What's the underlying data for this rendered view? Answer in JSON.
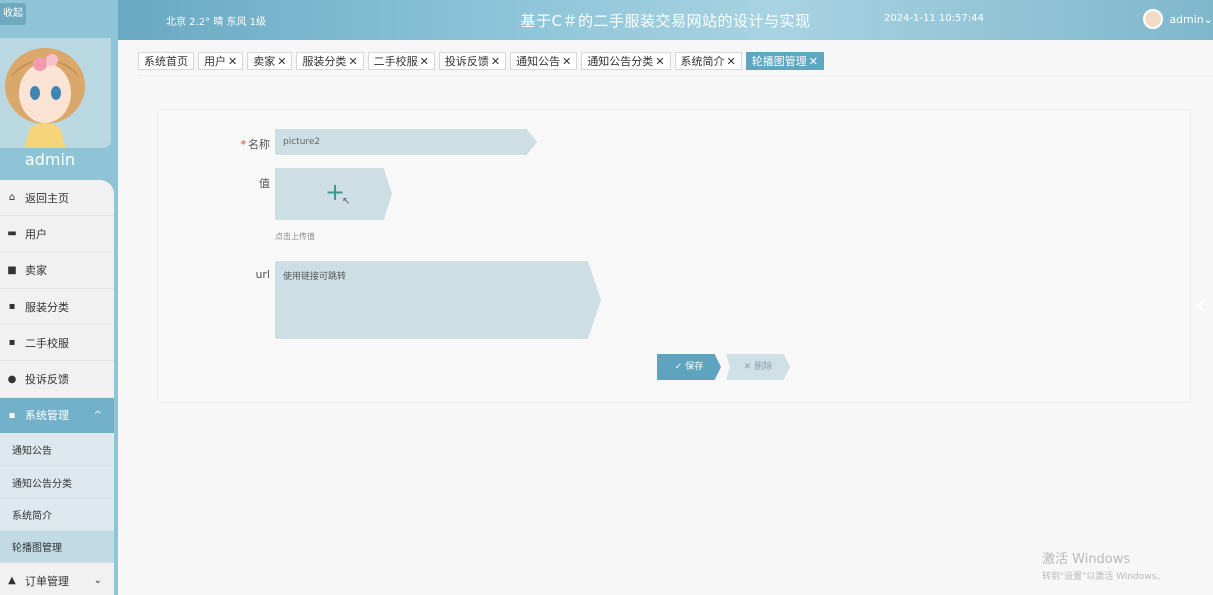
{
  "sidebar": {
    "collapse_label": "收起",
    "username": "admin",
    "menu": [
      {
        "label": "返回主页",
        "icon": "home-icon",
        "glyph": "⌂"
      },
      {
        "label": "用户",
        "icon": "user-icon",
        "glyph": "▬"
      },
      {
        "label": "卖家",
        "icon": "seller-icon",
        "glyph": "■"
      },
      {
        "label": "服装分类",
        "icon": "grid-icon",
        "glyph": "▪"
      },
      {
        "label": "二手校服",
        "icon": "grid-icon",
        "glyph": "▪"
      },
      {
        "label": "投诉反馈",
        "icon": "pin-icon",
        "glyph": "●"
      }
    ],
    "system_menu": {
      "label": "系统管理",
      "icon": "grid-icon",
      "glyph": "▪",
      "caret": "^"
    },
    "sub_items": [
      "通知公告",
      "通知公告分类",
      "系统简介",
      "轮播图管理"
    ],
    "order_menu": {
      "label": "订单管理",
      "icon": "person-icon",
      "glyph": "▲",
      "caret": "⌄"
    }
  },
  "header": {
    "weather": "北京  2.2°  晴  东风  1级",
    "title": "基于C＃的二手服装交易网站的设计与实现",
    "datetime": "2024-1-11 10:57:44",
    "username": "admin",
    "dropdown_glyph": "⌄"
  },
  "tabs": [
    {
      "label": "系统首页",
      "closable": false
    },
    {
      "label": "用户",
      "closable": true
    },
    {
      "label": "卖家",
      "closable": true
    },
    {
      "label": "服装分类",
      "closable": true
    },
    {
      "label": "二手校服",
      "closable": true
    },
    {
      "label": "投诉反馈",
      "closable": true
    },
    {
      "label": "通知公告",
      "closable": true
    },
    {
      "label": "通知公告分类",
      "closable": true
    },
    {
      "label": "系统简介",
      "closable": true
    },
    {
      "label": "轮播图管理",
      "closable": true,
      "active": true
    }
  ],
  "form": {
    "name_label": "名称",
    "name_required_mark": "*",
    "name_value": "picture2",
    "value_label": "值",
    "upload_hint": "点击上传值",
    "url_label": "url",
    "url_value": "使用链接可跳转",
    "save_label": "✓ 保存",
    "delete_label": "✕ 删除"
  },
  "watermark": {
    "title": "激活 Windows",
    "subtitle": "转到\"设置\"以激活 Windows。"
  },
  "colors": {
    "accent": "#5fa6c1",
    "sidebar_bg": "#8fc3d6",
    "input_bg": "#cddfe5"
  }
}
